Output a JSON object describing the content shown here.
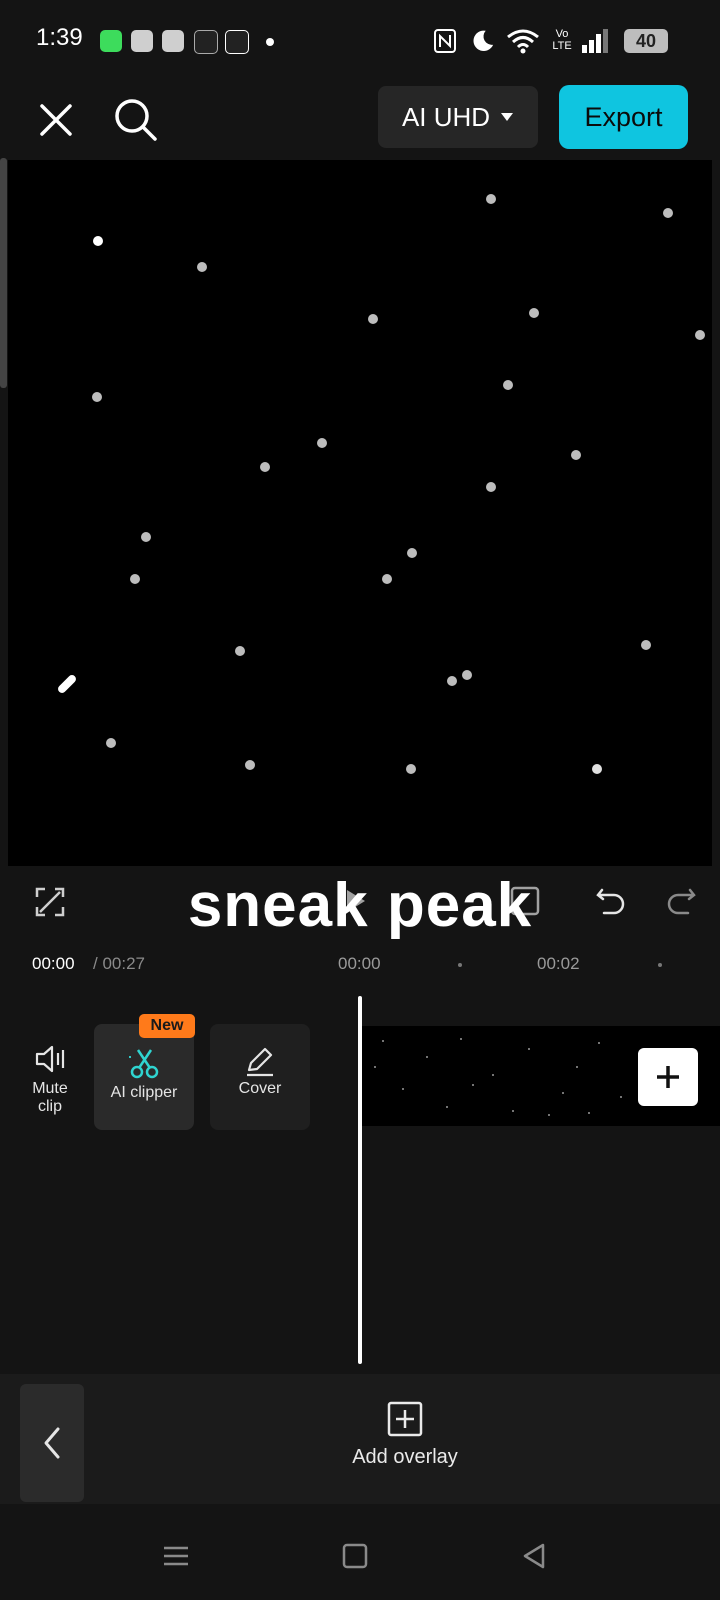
{
  "status_bar": {
    "time": "1:39",
    "battery": "40",
    "network": "Vo LTE"
  },
  "toolbar": {
    "quality_label": "AI UHD",
    "export_label": "Export"
  },
  "caption": {
    "text": "sneak peak"
  },
  "timeline": {
    "current_time": "00:00",
    "total_time": "/ 00:27",
    "ticks": [
      "00:00",
      "00:02"
    ]
  },
  "tools": {
    "mute_label_1": "Mute",
    "mute_label_2": "clip",
    "ai_clipper_label": "AI clipper",
    "new_badge": "New",
    "cover_label": "Cover"
  },
  "bottom": {
    "add_overlay_label": "Add overlay"
  },
  "colors": {
    "accent": "#0fc5e0",
    "badge": "#ff7a1a",
    "background": "#141414"
  },
  "icons": [
    "close-icon",
    "search-icon",
    "caret-down-icon",
    "fullscreen-icon",
    "play-icon",
    "keyframe-icon",
    "undo-icon",
    "redo-icon",
    "speaker-icon",
    "scissors-icon",
    "pencil-icon",
    "plus-icon",
    "chevron-left-icon",
    "add-box-icon",
    "menu-icon",
    "home-icon",
    "back-icon"
  ]
}
